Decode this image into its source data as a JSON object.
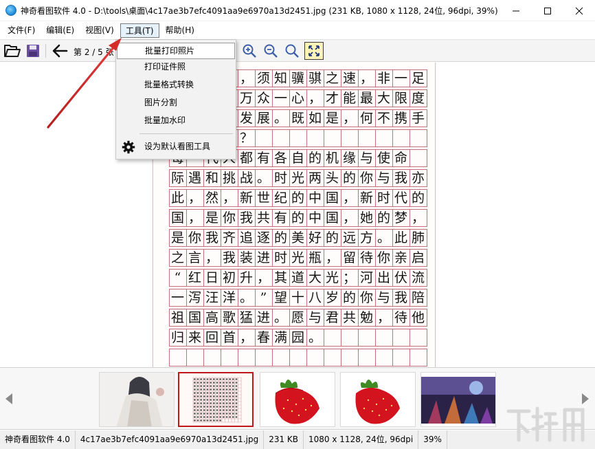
{
  "window": {
    "title": "神奇看图软件 4.0 - D:\\tools\\桌面\\4c17ae3b7efc4091aa9e6970a13d2451.jpg (231 KB, 1080 x 1128, 24位, 96dpi, 39%)",
    "controls": [
      "minimize-icon",
      "maximize-icon",
      "close-icon"
    ]
  },
  "menubar": {
    "items": [
      {
        "label": "文件(F)"
      },
      {
        "label": "编辑(E)"
      },
      {
        "label": "视图(V)"
      },
      {
        "label": "工具(T)",
        "active": true
      },
      {
        "label": "帮助(H)"
      }
    ]
  },
  "toolbar": {
    "page_indicator": "第 2 / 5 张",
    "icons": [
      "open-folder-icon",
      "save-icon",
      "back-arrow-icon",
      "zoom-in-icon",
      "zoom-out-icon",
      "actual-size-icon",
      "fit-window-icon"
    ]
  },
  "tools_menu": {
    "items": [
      {
        "label": "批量打印照片",
        "highlighted": true
      },
      {
        "label": "打印证件照"
      },
      {
        "label": "批量格式转换"
      },
      {
        "label": "图片分割"
      },
      {
        "label": "批量加水印"
      }
    ],
    "default_item": {
      "label": "设为默认看图工具",
      "icon": "gear-icon"
    }
  },
  "document": {
    "rows": [
      "，须知骥骐之速，非一足之",
      "万众一心，才能最大限度地",
      "发展。既如是，何不携手共",
      "？",
      "每一代人都有各自的机缘与使命",
      "际遇和挑战。时光两头的你与我亦如",
      "此，然，新世纪的中国，新时代的中",
      "国，是你我共有的中国，她的梦，当",
      "是你我齐追逐的美好的远方。此肺腑",
      "之言，我装进时光瓶，留待你亲启。",
      "“红日初升，其道大光；河出伏流",
      "一泻汪洋。”望十八岁的你与我陪伴着",
      "祖国高歌猛进。愿与君共勉，待他日",
      "归来回首，春满园。",
      "",
      ""
    ]
  },
  "thumbnails": [
    {
      "name": "thumb-character-art",
      "selected": false
    },
    {
      "name": "thumb-handwritten-page",
      "selected": true
    },
    {
      "name": "thumb-strawberry-1",
      "selected": false
    },
    {
      "name": "thumb-strawberry-2",
      "selected": false
    },
    {
      "name": "thumb-game-scene",
      "selected": false
    }
  ],
  "statusbar": {
    "app": "神奇看图软件 4.0",
    "filename": "4c17ae3b7efc4091aa9e6970a13d2451.jpg",
    "size": "231 KB",
    "info": "1080 x 1128, 24位, 96dpi",
    "zoom": "39%"
  },
  "colors": {
    "grid_line": "#c8707a",
    "selected_thumb_border": "#c01818",
    "annotation_arrow": "#d42a2a",
    "menu_active_bg": "#e5f1fb"
  }
}
